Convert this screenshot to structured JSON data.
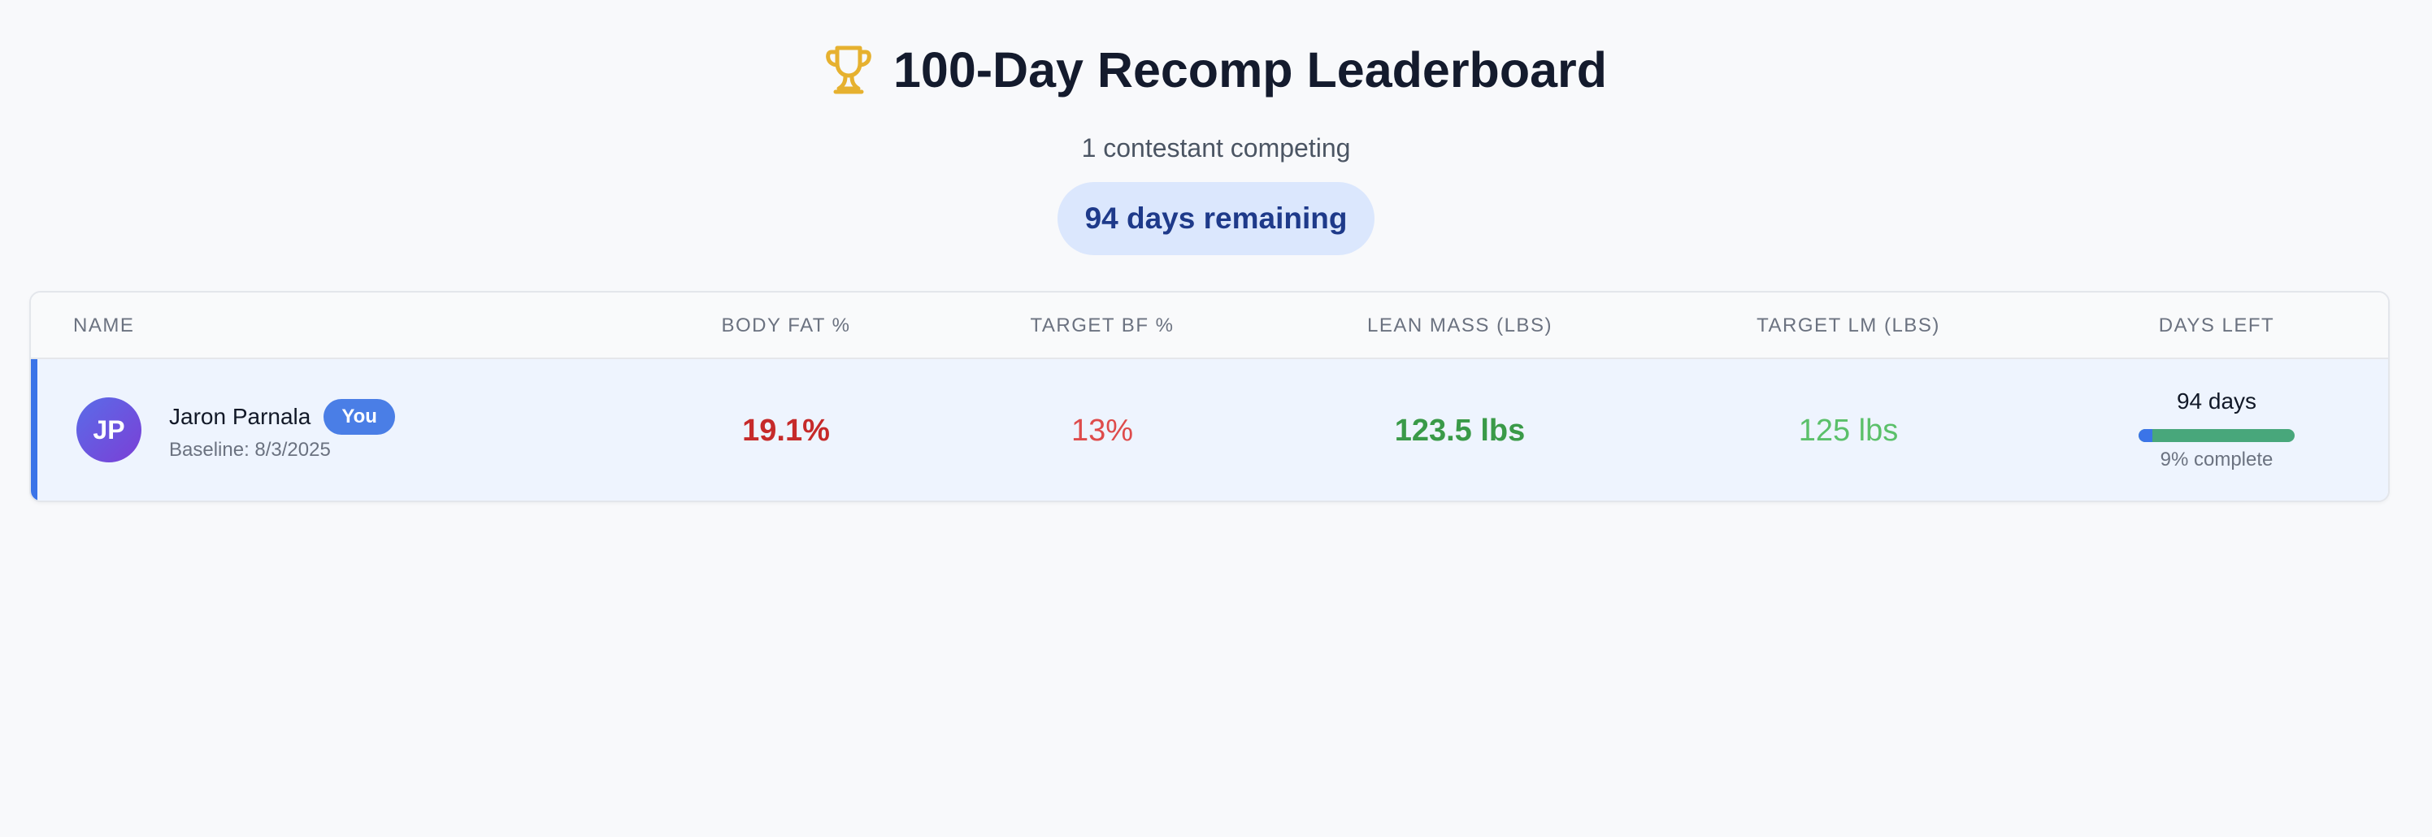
{
  "header": {
    "trophy_icon": "trophy-icon",
    "title": "100-Day Recomp Leaderboard",
    "subtitle": "1 contestant competing",
    "remaining_pill": "94 days remaining"
  },
  "table": {
    "columns": {
      "name": "NAME",
      "body_fat": "BODY FAT %",
      "target_bf": "TARGET BF %",
      "lean_mass": "LEAN MASS (LBS)",
      "target_lm": "TARGET LM (LBS)",
      "days_left": "DAYS LEFT"
    },
    "rows": [
      {
        "initials": "JP",
        "name": "Jaron Parnala",
        "badge": "You",
        "baseline": "Baseline: 8/3/2025",
        "body_fat": "19.1%",
        "target_bf": "13%",
        "lean_mass": "123.5 lbs",
        "target_lm": "125 lbs",
        "days_left": "94 days",
        "progress_fraction": 0.09,
        "progress_label": "9% complete"
      }
    ]
  },
  "colors": {
    "accent": "#3b74e8",
    "body_fat": "#c62a2a",
    "target_bf": "#de4b4b",
    "lean_mass": "#3a9a48",
    "target_lm": "#5bc06a",
    "trophy": "#e6b12f",
    "progress_remaining": "#48a77b"
  }
}
